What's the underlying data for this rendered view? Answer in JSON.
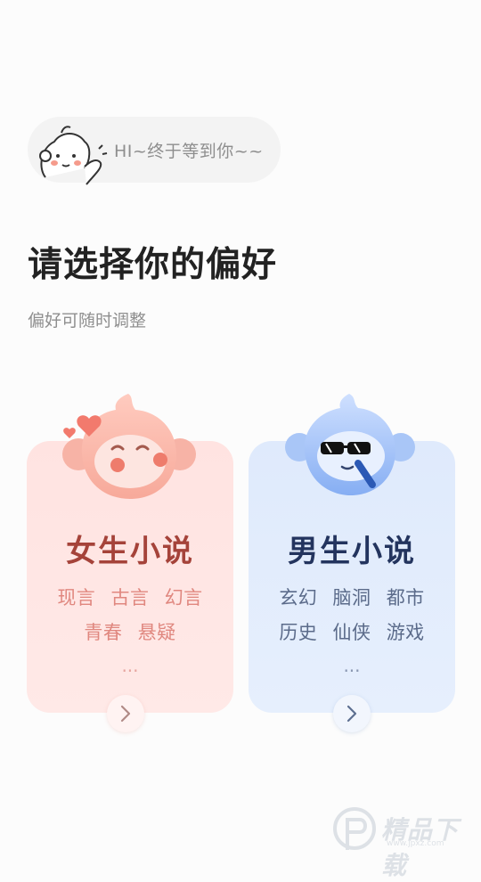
{
  "greeting": {
    "text": "HI~终于等到你~~",
    "icon": "monkey-waving-icon"
  },
  "header": {
    "title": "请选择你的偏好",
    "subtitle": "偏好可随时调整"
  },
  "cards": [
    {
      "name": "女生小说",
      "tags_row1": [
        "现言",
        "古言",
        "幻言"
      ],
      "tags_row2": [
        "青春",
        "悬疑"
      ],
      "more": "...",
      "accent": "#a5433a",
      "background": "#ffe3e1"
    },
    {
      "name": "男生小说",
      "tags_row1": [
        "玄幻",
        "脑洞",
        "都市"
      ],
      "tags_row2": [
        "历史",
        "仙侠",
        "游戏"
      ],
      "more": "...",
      "accent": "#23345e",
      "background": "#dfeafc"
    }
  ],
  "watermark": {
    "text": "精品下载",
    "url": "www.jpxz.com"
  }
}
